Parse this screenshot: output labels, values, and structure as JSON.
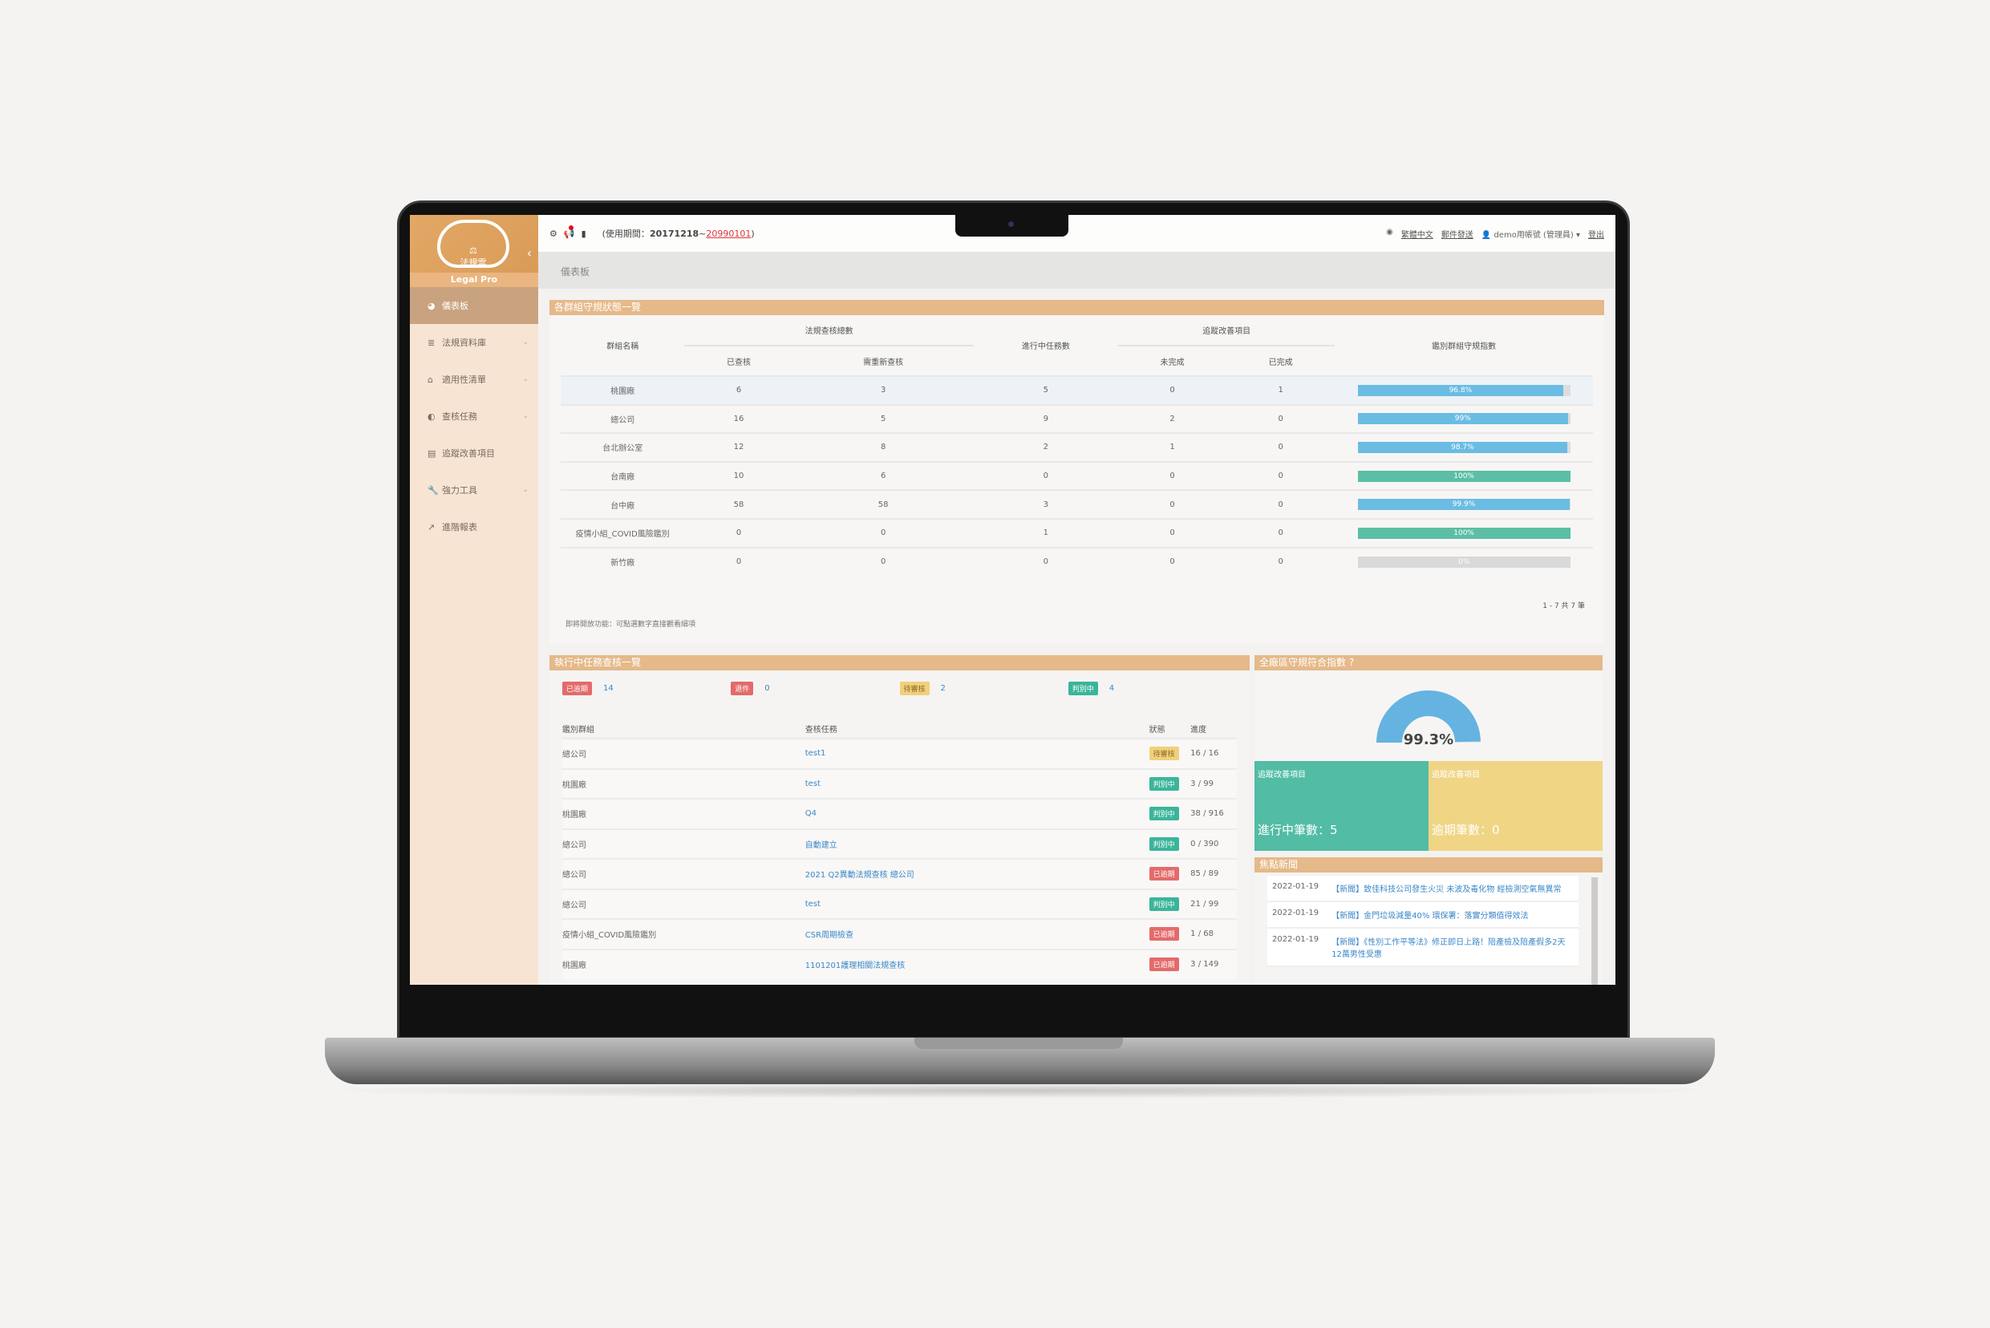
{
  "app": {
    "logo_text": "法規雲",
    "logo_sub": "Legal",
    "product": "Legal Pro"
  },
  "topbar": {
    "period_label": "(使用期間：",
    "period_start": "20171218",
    "period_sep": " ~ ",
    "period_end": "20990101",
    "period_close": ")",
    "language": "繁體中文",
    "mail": "郵件發送",
    "user": "demo用帳號 (管理員)",
    "logout": "登出"
  },
  "breadcrumb": "儀表板",
  "sidebar": {
    "items": [
      {
        "label": "儀表板",
        "icon": "dashboard-icon",
        "active": true
      },
      {
        "label": "法規資料庫",
        "icon": "database-icon",
        "expandable": true
      },
      {
        "label": "適用性清單",
        "icon": "home-icon",
        "expandable": true
      },
      {
        "label": "查核任務",
        "icon": "eye-icon",
        "expandable": true
      },
      {
        "label": "追蹤改善項目",
        "icon": "clipboard-icon",
        "expandable": false
      },
      {
        "label": "強力工具",
        "icon": "wrench-icon",
        "expandable": true
      },
      {
        "label": "進階報表",
        "icon": "chart-icon",
        "expandable": false
      }
    ]
  },
  "group_status": {
    "title": "各群組守規狀態一覽",
    "headers": {
      "group": "群組名稱",
      "audit_total": "法規查核總數",
      "audited": "已查核",
      "reaudit": "需重新查核",
      "in_progress": "進行中任務數",
      "tracking": "追蹤改善項目",
      "incomplete": "未完成",
      "complete": "已完成",
      "index": "鑑別群組守規指數"
    },
    "rows": [
      {
        "group": "桃園廠",
        "audited": "6",
        "reaudit": "3",
        "in_progress": "5",
        "incomplete": "0",
        "complete": "1",
        "index": "96.8%",
        "value": 96.8,
        "color": "#6bbce3"
      },
      {
        "group": "總公司",
        "audited": "16",
        "reaudit": "5",
        "in_progress": "9",
        "incomplete": "2",
        "complete": "0",
        "index": "99%",
        "value": 99,
        "color": "#6bbce3"
      },
      {
        "group": "台北辦公室",
        "audited": "12",
        "reaudit": "8",
        "in_progress": "2",
        "incomplete": "1",
        "complete": "0",
        "index": "98.7%",
        "value": 98.7,
        "color": "#6bbce3"
      },
      {
        "group": "台南廠",
        "audited": "10",
        "reaudit": "6",
        "in_progress": "0",
        "incomplete": "0",
        "complete": "0",
        "index": "100%",
        "value": 100,
        "color": "#5bbea5"
      },
      {
        "group": "台中廠",
        "audited": "58",
        "reaudit": "58",
        "in_progress": "3",
        "incomplete": "0",
        "complete": "0",
        "index": "99.9%",
        "value": 99.9,
        "color": "#6bbce3"
      },
      {
        "group": "疫情小組_COVID風險鑑別",
        "audited": "0",
        "reaudit": "0",
        "in_progress": "1",
        "incomplete": "0",
        "complete": "0",
        "index": "100%",
        "value": 100,
        "color": "#5bbea5"
      },
      {
        "group": "新竹廠",
        "audited": "0",
        "reaudit": "0",
        "in_progress": "0",
        "incomplete": "0",
        "complete": "0",
        "index": "0%",
        "value": 0,
        "color": "#d9d9d9"
      }
    ],
    "note": "即將開放功能：可點選數字直接觀看細項",
    "pager": "1 - 7 共 7 筆"
  },
  "tasks": {
    "title": "執行中任務查核一覽",
    "counts": [
      {
        "label": "已逾期",
        "value": "14",
        "color": "#e46a6a"
      },
      {
        "label": "退件",
        "value": "0",
        "color": "#e46a6a"
      },
      {
        "label": "待審核",
        "value": "2",
        "color": "#f0d07a"
      },
      {
        "label": "判別中",
        "value": "4",
        "color": "#3bb59a"
      }
    ],
    "headers": {
      "group": "鑑別群組",
      "task": "查核任務",
      "status": "狀態",
      "progress": "進度"
    },
    "rows": [
      {
        "group": "總公司",
        "task": "test1",
        "status": "待審核",
        "color": "#f0d07a",
        "progress": "16 / 16"
      },
      {
        "group": "桃園廠",
        "task": "test",
        "status": "判別中",
        "color": "#3bb59a",
        "progress": "3 / 99"
      },
      {
        "group": "桃園廠",
        "task": "Q4",
        "status": "判別中",
        "color": "#3bb59a",
        "progress": "38 / 916"
      },
      {
        "group": "總公司",
        "task": "自動建立",
        "status": "判別中",
        "color": "#3bb59a",
        "progress": "0 / 390"
      },
      {
        "group": "總公司",
        "task": "2021 Q2異動法規查核 總公司",
        "status": "已逾期",
        "color": "#e46a6a",
        "progress": "85 / 89"
      },
      {
        "group": "總公司",
        "task": "test",
        "status": "判別中",
        "color": "#3bb59a",
        "progress": "21 / 99"
      },
      {
        "group": "疫情小組_COVID風險鑑別",
        "task": "CSR周期檢查",
        "status": "已逾期",
        "color": "#e46a6a",
        "progress": "1 / 68"
      },
      {
        "group": "桃園廠",
        "task": "1101201護理相關法規查核",
        "status": "已逾期",
        "color": "#e46a6a",
        "progress": "3 / 149"
      }
    ]
  },
  "compliance": {
    "title": "全廠區守規符合指數",
    "value_label": "99.3%",
    "value": 99.3,
    "gauge_color": "#65b3e0"
  },
  "tiles": [
    {
      "label": "追蹤改善項目",
      "big": "進行中筆數：5",
      "color": "#52bca5"
    },
    {
      "label": "追蹤改善項目",
      "big": "逾期筆數：0",
      "color": "#f0d585"
    }
  ],
  "news": {
    "title": "焦點新聞",
    "items": [
      {
        "date": "2022-01-19",
        "title": "【新聞】致佳科技公司發生火災 未波及毒化物 經檢測空氣無異常"
      },
      {
        "date": "2022-01-19",
        "title": "【新聞】金門垃圾減量40% 環保署：落實分類值得效法"
      },
      {
        "date": "2022-01-19",
        "title": "【新聞】《性別工作平等法》修正即日上路！陪產檢及陪產假多2天　12萬男性受惠"
      }
    ]
  }
}
